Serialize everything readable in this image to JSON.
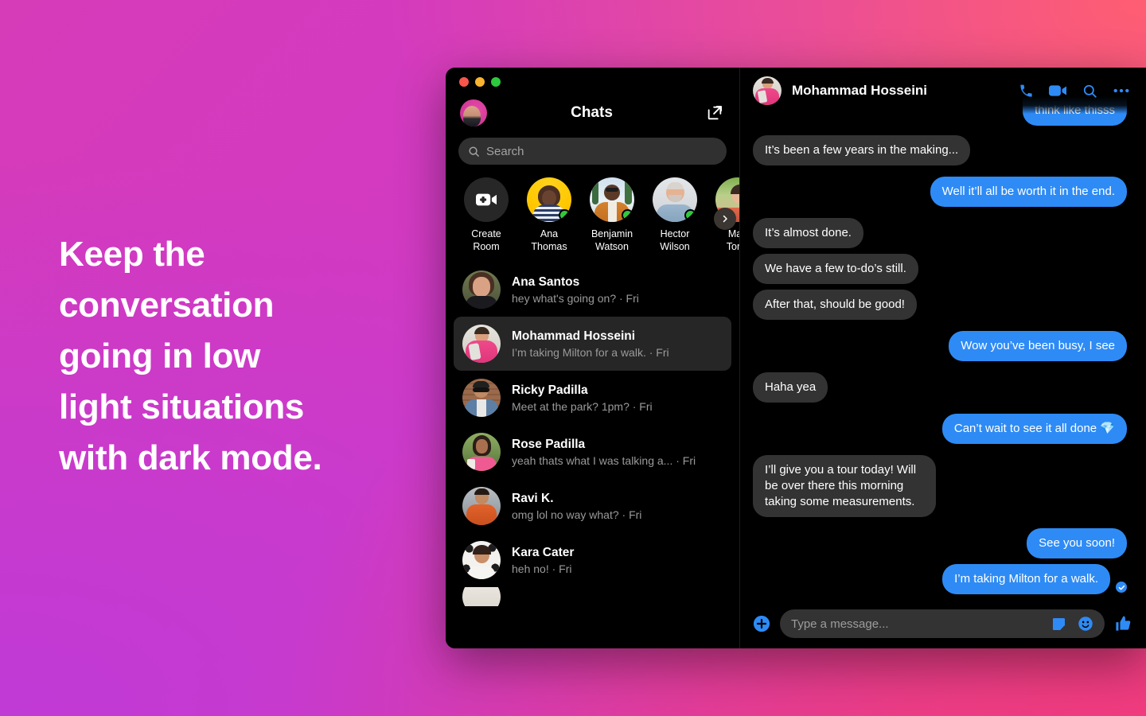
{
  "promo": {
    "lines": [
      "Keep the",
      "conversation",
      "going in low",
      "light situations",
      "with dark mode."
    ]
  },
  "theme": {
    "accent_blue": "#2e8bf5",
    "bubble_incoming": "#333333",
    "window_bg": "#000000",
    "selected_row": "#262626",
    "online_green": "#31c83e",
    "bg_top_left": "#d63bb8",
    "bg_top_right": "#ff5e72",
    "bg_bottom_left": "#c03ad6",
    "bg_bottom_right": "#f03b7e"
  },
  "sidebar": {
    "title": "Chats",
    "compose_icon": "compose-icon",
    "profile_avatar": "user-avatar",
    "search": {
      "placeholder": "Search",
      "icon": "search-icon"
    },
    "active_now": {
      "next_icon": "chevron-right-icon",
      "items": [
        {
          "label": "Create\nRoom",
          "type": "create-room",
          "icon": "video-plus-icon",
          "online": false
        },
        {
          "label": "Ana\nThomas",
          "type": "person",
          "online": true
        },
        {
          "label": "Benjamin\nWatson",
          "type": "person",
          "online": true
        },
        {
          "label": "Hector\nWilson",
          "type": "person",
          "online": true
        },
        {
          "label": "Mari\nTorre",
          "type": "person",
          "online": false
        }
      ]
    },
    "chats": [
      {
        "name": "Ana Santos",
        "preview": "hey what's going on? · Fri",
        "selected": false
      },
      {
        "name": "Mohammad Hosseini",
        "preview": "I’m taking Milton for a walk. · Fri",
        "selected": true
      },
      {
        "name": "Ricky Padilla",
        "preview": "Meet at the park? 1pm? · Fri",
        "selected": false
      },
      {
        "name": "Rose Padilla",
        "preview": "yeah thats what I was talking a... · Fri",
        "selected": false
      },
      {
        "name": "Ravi K.",
        "preview": "omg lol no way what? · Fri",
        "selected": false
      },
      {
        "name": "Kara Cater",
        "preview": "heh no! · Fri",
        "selected": false
      }
    ]
  },
  "conversation": {
    "contact_name": "Mohammad Hosseini",
    "actions": [
      {
        "name": "voice-call-icon",
        "label": "Voice call"
      },
      {
        "name": "video-call-icon",
        "label": "Video call"
      },
      {
        "name": "search-conversation-icon",
        "label": "Search"
      },
      {
        "name": "more-options-icon",
        "label": "More"
      }
    ],
    "messages": [
      {
        "dir": "out",
        "text": "think like thisss",
        "clipped": true
      },
      {
        "dir": "in",
        "text": "It’s been a few years in the making..."
      },
      {
        "dir": "out",
        "text": "Well it’ll all be worth it in the end."
      },
      {
        "dir": "in",
        "text": "It’s almost done."
      },
      {
        "dir": "in",
        "text": "We have a few to-do’s still."
      },
      {
        "dir": "in",
        "text": "After that, should be good!"
      },
      {
        "dir": "out",
        "text": "Wow you’ve been busy, I see"
      },
      {
        "dir": "in",
        "text": "Haha yea"
      },
      {
        "dir": "out",
        "text": "Can’t wait to see it all done 💎"
      },
      {
        "dir": "in",
        "text": "I’ll give you a tour today! Will be over there this morning taking some measurements.",
        "multiline": true
      },
      {
        "dir": "out",
        "text": "See you soon!"
      },
      {
        "dir": "out",
        "text": "I’m taking Milton for a walk.",
        "seen": true
      }
    ],
    "composer": {
      "add_icon": "plus-circle-icon",
      "placeholder": "Type a message...",
      "sticker_icon": "sticker-icon",
      "emoji_icon": "emoji-icon",
      "like_icon": "thumbs-up-icon"
    }
  },
  "window_controls": {
    "close": "close-window-button",
    "minimize": "minimize-window-button",
    "maximize": "maximize-window-button"
  }
}
